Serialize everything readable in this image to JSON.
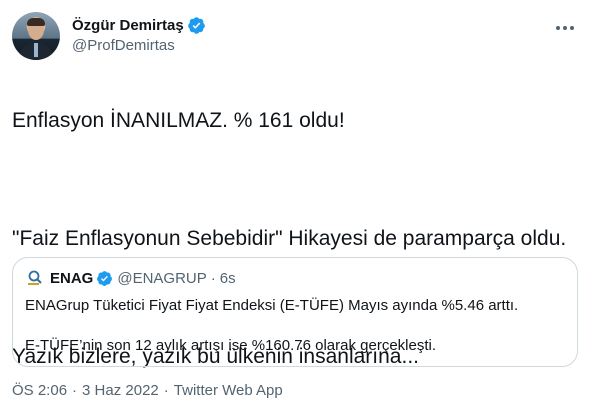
{
  "author": {
    "display_name": "Özgür Demirtaş",
    "handle": "@ProfDemirtas",
    "verified_icon": "verified-badge-icon"
  },
  "tweet": {
    "line1": "Enflasyon İNANILMAZ. % 161 oldu!",
    "line2": "\"Faiz Enflasyonun Sebebidir\" Hikayesi de paramparça oldu.",
    "line3": "Yazık bizlere, yazık bu ülkenin insanlarına..."
  },
  "quote": {
    "display_name": "ENAG",
    "handle": "@ENAGRUP",
    "separator": "·",
    "time": "6s",
    "text1": "ENAGrup Tüketici Fiyat Fiyat Endeksi (E-TÜFE) Mayıs ayında %5.46 arttı.",
    "text2": "E-TÜFE’nin son 12 aylık artışı ise %160.76 olarak gerçekleşti."
  },
  "meta": {
    "time": "ÖS 2:06",
    "separator": "·",
    "date": "3 Haz 2022",
    "source": "Twitter Web App"
  },
  "colors": {
    "verified": "#1d9bf0",
    "secondary_text": "#536471",
    "border": "#cfd9de"
  }
}
